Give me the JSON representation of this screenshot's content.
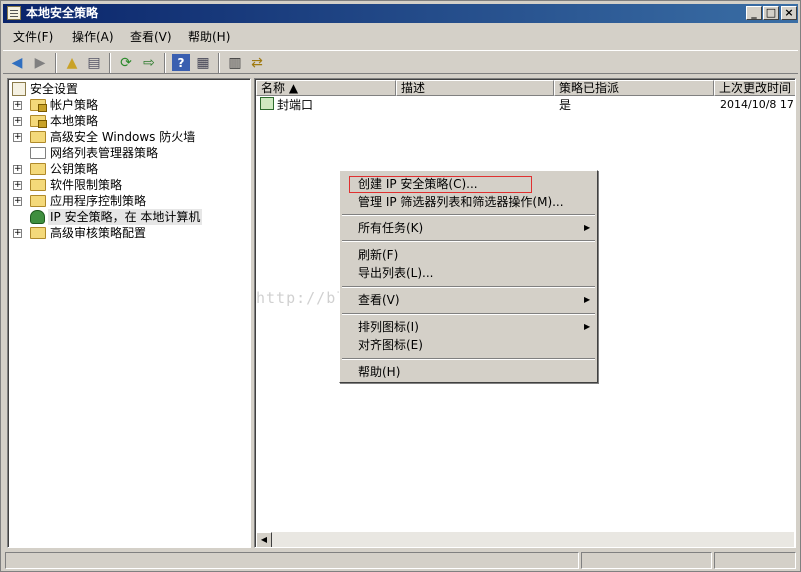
{
  "window": {
    "title": "本地安全策略"
  },
  "menubar": {
    "file": "文件(F)",
    "action": "操作(A)",
    "view": "查看(V)",
    "help": "帮助(H)"
  },
  "toolbar": {
    "icons": [
      "back-arrow-icon",
      "forward-arrow-icon",
      "up-folder-icon",
      "show-hide-tree-icon",
      "refresh-icon",
      "export-list-icon",
      "help-icon",
      "console-tree-icon",
      "properties-icon",
      "manage-filters-icon"
    ]
  },
  "tree": {
    "root": "安全设置",
    "items": [
      {
        "label": "帐户策略",
        "expandable": true,
        "icon": "folder-lock"
      },
      {
        "label": "本地策略",
        "expandable": true,
        "icon": "folder-lock"
      },
      {
        "label": "高级安全 Windows 防火墙",
        "expandable": true,
        "icon": "folder"
      },
      {
        "label": "网络列表管理器策略",
        "expandable": false,
        "icon": "folder-open"
      },
      {
        "label": "公钥策略",
        "expandable": true,
        "icon": "folder"
      },
      {
        "label": "软件限制策略",
        "expandable": true,
        "icon": "folder"
      },
      {
        "label": "应用程序控制策略",
        "expandable": true,
        "icon": "folder"
      },
      {
        "label": "IP 安全策略，在 本地计算机",
        "expandable": false,
        "icon": "ipsec",
        "selected": true
      },
      {
        "label": "高级审核策略配置",
        "expandable": true,
        "icon": "folder"
      }
    ]
  },
  "list": {
    "columns": [
      "名称 ▲",
      "描述",
      "策略已指派",
      "上次更改时间"
    ],
    "rows": [
      {
        "name": "封端口",
        "description": "",
        "assigned": "是",
        "modified": "2014/10/8 17:"
      }
    ]
  },
  "context_menu": {
    "items": [
      {
        "label": "创建 IP 安全策略(C)...",
        "submenu": false,
        "highlighted": true
      },
      {
        "label": "管理 IP 筛选器列表和筛选器操作(M)...",
        "submenu": false
      },
      {
        "label": "所有任务(K)",
        "submenu": true
      },
      {
        "label": "刷新(F)",
        "submenu": false
      },
      {
        "label": "导出列表(L)...",
        "submenu": false
      },
      {
        "label": "查看(V)",
        "submenu": true
      },
      {
        "label": "排列图标(I)",
        "submenu": true
      },
      {
        "label": "对齐图标(E)",
        "submenu": false
      },
      {
        "label": "帮助(H)",
        "submenu": false
      }
    ]
  },
  "watermark": {
    "text": "http://blog.csdn.net/z362667160"
  },
  "colors": {
    "title_gradient_start": "#0a246a",
    "title_gradient_end": "#3a6ea5",
    "window_face": "#d4d0c8",
    "highlight_box": "#e03030"
  }
}
